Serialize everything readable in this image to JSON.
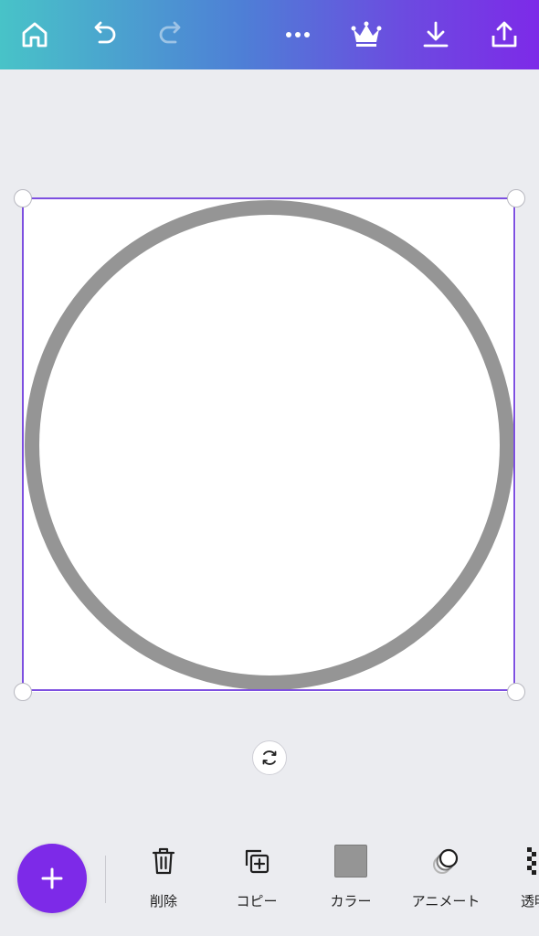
{
  "top_bar": {
    "home": "home-icon",
    "undo": "undo-icon",
    "redo": "redo-icon",
    "more": "more-icon",
    "premium": "crown-icon",
    "download": "download-icon",
    "share": "share-icon"
  },
  "design": {
    "shape": "circle-outline",
    "stroke_color": "#959595",
    "fill_color": "#ffffff",
    "selection_color": "#7d4fe0"
  },
  "toolbar": {
    "add_icon": "plus-icon",
    "items": [
      {
        "label": "削除",
        "icon": "trash-icon"
      },
      {
        "label": "コピー",
        "icon": "copy-icon"
      },
      {
        "label": "カラー",
        "icon": "color-swatch",
        "color": "#959595"
      },
      {
        "label": "アニメート",
        "icon": "animate-icon"
      },
      {
        "label": "透明",
        "icon": "transparency-icon"
      }
    ]
  },
  "colors": {
    "brand_purple": "#7d2ae8",
    "gradient_start": "#48c3c8",
    "gradient_end": "#7d2ae8",
    "background": "#ebecf0"
  }
}
